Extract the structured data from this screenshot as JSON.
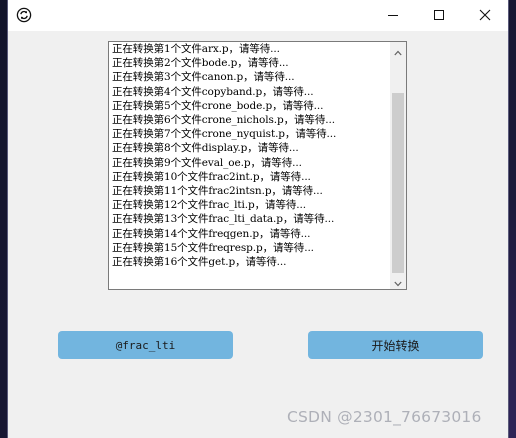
{
  "window": {
    "app_icon": "refresh-circle-icon",
    "controls": {
      "minimize_icon": "minimize-icon",
      "maximize_icon": "maximize-icon",
      "close_icon": "close-icon"
    }
  },
  "log": {
    "lines": [
      "正在转换第1个文件arx.p，请等待...",
      "正在转换第2个文件bode.p，请等待...",
      "正在转换第3个文件canon.p，请等待...",
      "正在转换第4个文件copyband.p，请等待...",
      "正在转换第5个文件crone_bode.p，请等待...",
      "正在转换第6个文件crone_nichols.p，请等待...",
      "正在转换第7个文件crone_nyquist.p，请等待...",
      "正在转换第8个文件display.p，请等待...",
      "正在转换第9个文件eval_oe.p，请等待...",
      "正在转换第10个文件frac2int.p，请等待...",
      "正在转换第11个文件frac2intsn.p，请等待...",
      "正在转换第12个文件frac_lti.p，请等待...",
      "正在转换第13个文件frac_lti_data.p，请等待...",
      "正在转换第14个文件freqgen.p，请等待...",
      "正在转换第15个文件freqresp.p，请等待...",
      "正在转换第16个文件get.p，请等待..."
    ],
    "scroll_up_icon": "scroll-up-arrow-icon",
    "scroll_down_icon": "scroll-down-arrow-icon"
  },
  "buttons": {
    "folder_label": "@frac_lti",
    "start_label": "开始转换"
  },
  "watermark": "CSDN @2301_76673016"
}
